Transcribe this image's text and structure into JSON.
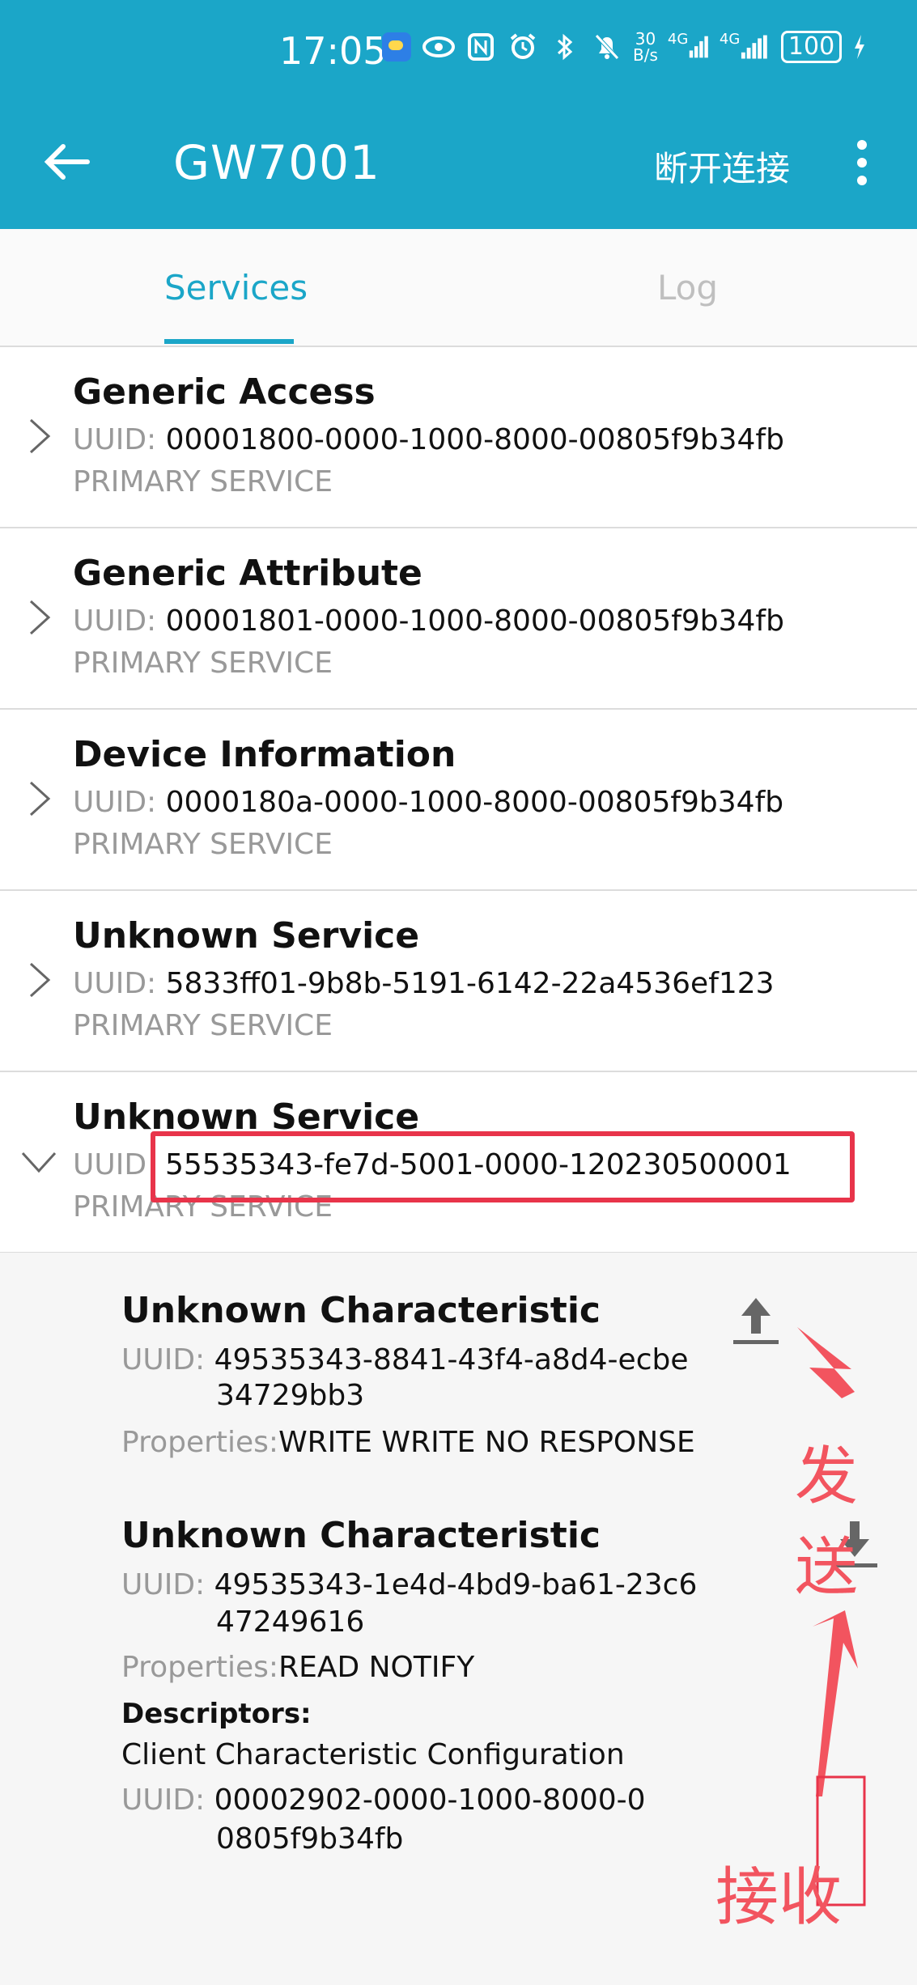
{
  "status_bar": {
    "time": "17:05",
    "net_speed_top": "30",
    "net_speed_bottom": "B/s",
    "signal1": "4G",
    "signal2": "4G",
    "battery": "100"
  },
  "toolbar": {
    "title": "GW7001",
    "disconnect_label": "断开连接"
  },
  "tabs": [
    {
      "label": "Services",
      "active": true
    },
    {
      "label": "Log",
      "active": false
    }
  ],
  "services": [
    {
      "name": "Generic Access",
      "uuid_label": "UUID:",
      "uuid": "00001800-0000-1000-8000-00805f9b34fb",
      "type": "PRIMARY SERVICE",
      "expanded": false
    },
    {
      "name": "Generic Attribute",
      "uuid_label": "UUID:",
      "uuid": "00001801-0000-1000-8000-00805f9b34fb",
      "type": "PRIMARY SERVICE",
      "expanded": false
    },
    {
      "name": "Device Information",
      "uuid_label": "UUID:",
      "uuid": "0000180a-0000-1000-8000-00805f9b34fb",
      "type": "PRIMARY SERVICE",
      "expanded": false
    },
    {
      "name": "Unknown Service",
      "uuid_label": "UUID:",
      "uuid": "5833ff01-9b8b-5191-6142-22a4536ef123",
      "type": "PRIMARY SERVICE",
      "expanded": false
    },
    {
      "name": "Unknown Service",
      "uuid_label": "UUID",
      "uuid": "55535343-fe7d-5001-0000-120230500001",
      "type": "PRIMARY SERVICE",
      "expanded": true
    }
  ],
  "characteristics": [
    {
      "name": "Unknown Characteristic",
      "uuid_label": "UUID:",
      "uuid_line1": "49535343-8841-43f4-a8d4-ecbe",
      "uuid_line2": "34729bb3",
      "properties_label": "Properties:",
      "properties": "WRITE WRITE NO RESPONSE",
      "action_icon": "upload-icon"
    },
    {
      "name": "Unknown Characteristic",
      "uuid_label": "UUID:",
      "uuid_line1": "49535343-1e4d-4bd9-ba61-23c6",
      "uuid_line2": "47249616",
      "properties_label": "Properties:",
      "properties": "READ NOTIFY",
      "action_icon": "download-icon",
      "descriptors_label": "Descriptors:",
      "descriptor_name": "Client Characteristic Configuration",
      "descriptor_uuid_label": "UUID:",
      "descriptor_uuid_line1": "00002902-0000-1000-8000-0",
      "descriptor_uuid_line2": "0805f9b34fb"
    }
  ],
  "annotations": {
    "send_label": "发送",
    "receive_label": "接收",
    "color": "#f2545f"
  },
  "colors": {
    "accent": "#1ba6c8",
    "highlight": "#e8344a"
  }
}
